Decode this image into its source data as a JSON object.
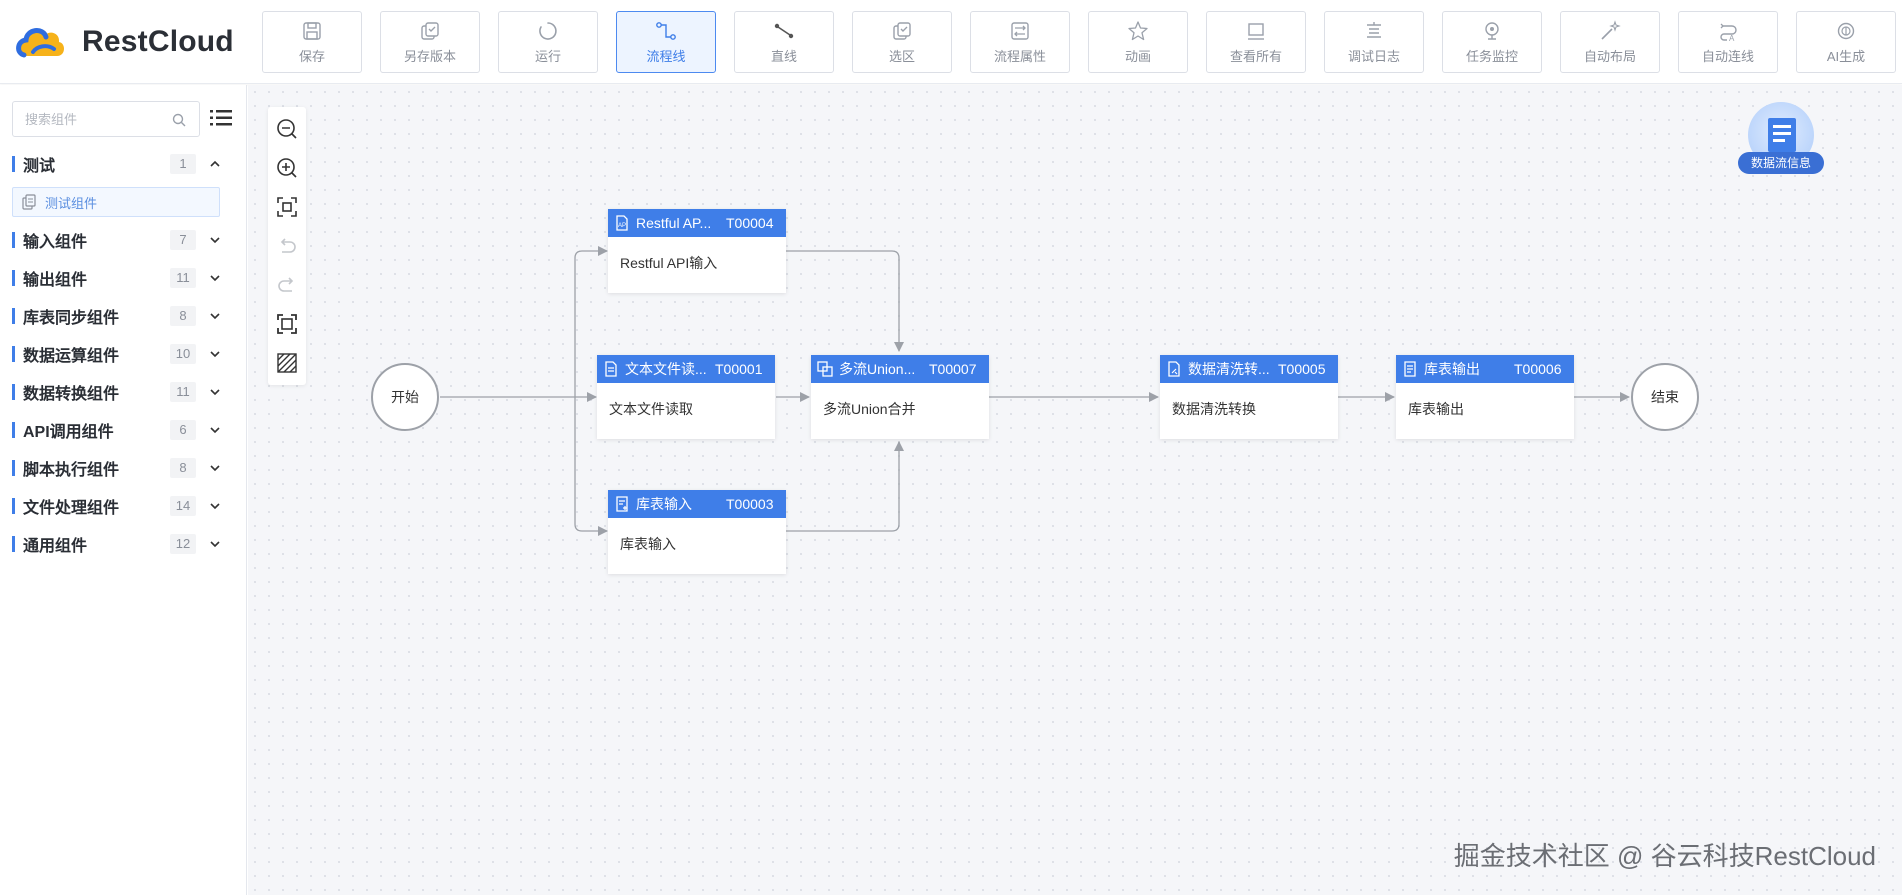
{
  "app": {
    "logo_text": "RestCloud"
  },
  "toolbar": {
    "buttons": [
      {
        "label": "保存",
        "icon": "save-icon",
        "active": false
      },
      {
        "label": "另存版本",
        "icon": "save-version-icon",
        "active": false
      },
      {
        "label": "运行",
        "icon": "run-icon",
        "active": false
      },
      {
        "label": "流程线",
        "icon": "flow-line-icon",
        "active": true
      },
      {
        "label": "直线",
        "icon": "straight-line-icon",
        "active": false
      },
      {
        "label": "选区",
        "icon": "select-area-icon",
        "active": false
      },
      {
        "label": "流程属性",
        "icon": "flow-properties-icon",
        "active": false
      },
      {
        "label": "动画",
        "icon": "animation-icon",
        "active": false
      },
      {
        "label": "查看所有",
        "icon": "view-all-icon",
        "active": false
      },
      {
        "label": "调试日志",
        "icon": "debug-log-icon",
        "active": false
      },
      {
        "label": "任务监控",
        "icon": "task-monitor-icon",
        "active": false
      },
      {
        "label": "自动布局",
        "icon": "auto-layout-icon",
        "active": false
      },
      {
        "label": "自动连线",
        "icon": "auto-connect-icon",
        "active": false
      },
      {
        "label": "AI生成",
        "icon": "ai-generate-icon",
        "active": false
      }
    ]
  },
  "sidebar": {
    "search_placeholder": "搜索组件",
    "groups": [
      {
        "name": "测试",
        "count": "1",
        "expanded": true,
        "items": [
          {
            "label": "测试组件"
          }
        ]
      },
      {
        "name": "输入组件",
        "count": "7",
        "expanded": false
      },
      {
        "name": "输出组件",
        "count": "11",
        "expanded": false
      },
      {
        "name": "库表同步组件",
        "count": "8",
        "expanded": false
      },
      {
        "name": "数据运算组件",
        "count": "10",
        "expanded": false
      },
      {
        "name": "数据转换组件",
        "count": "11",
        "expanded": false
      },
      {
        "name": "API调用组件",
        "count": "6",
        "expanded": false
      },
      {
        "name": "脚本执行组件",
        "count": "8",
        "expanded": false
      },
      {
        "name": "文件处理组件",
        "count": "14",
        "expanded": false
      },
      {
        "name": "通用组件",
        "count": "12",
        "expanded": false
      }
    ]
  },
  "canvas_tools": [
    {
      "name": "zoom-out-icon",
      "enabled": true
    },
    {
      "name": "zoom-in-icon",
      "enabled": true
    },
    {
      "name": "fit-view-icon",
      "enabled": true
    },
    {
      "name": "undo-icon",
      "enabled": false
    },
    {
      "name": "redo-icon",
      "enabled": false
    },
    {
      "name": "fullscreen-icon",
      "enabled": true
    },
    {
      "name": "grid-toggle-icon",
      "enabled": true
    }
  ],
  "flow": {
    "start": {
      "label": "开始"
    },
    "end": {
      "label": "结束"
    },
    "nodes": {
      "n_restful": {
        "title": "Restful AP...",
        "code": "T00004",
        "body": "Restful API输入",
        "icon": "api-file-icon"
      },
      "n_text": {
        "title": "文本文件读...",
        "code": "T00001",
        "body": "文本文件读取",
        "icon": "text-file-icon"
      },
      "n_table_in": {
        "title": "库表输入",
        "code": "T00003",
        "body": "库表输入",
        "icon": "table-input-icon"
      },
      "n_union": {
        "title": "多流Union...",
        "code": "T00007",
        "body": "多流Union合并",
        "icon": "union-icon"
      },
      "n_clean": {
        "title": "数据清洗转...",
        "code": "T00005",
        "body": "数据清洗转换",
        "icon": "data-clean-icon"
      },
      "n_table_out": {
        "title": "库表输出",
        "code": "T00006",
        "body": "库表输出",
        "icon": "table-output-icon"
      }
    }
  },
  "info_widget": {
    "label": "数据流信息",
    "icon": "dataflow-info-icon"
  },
  "watermark": "掘金技术社区 @ 谷云科技RestCloud",
  "colors": {
    "accent": "#3f7ee8",
    "node_header": "#3f7ee8",
    "canvas_bg": "#f5f6f9",
    "connector": "#9da1a8"
  }
}
